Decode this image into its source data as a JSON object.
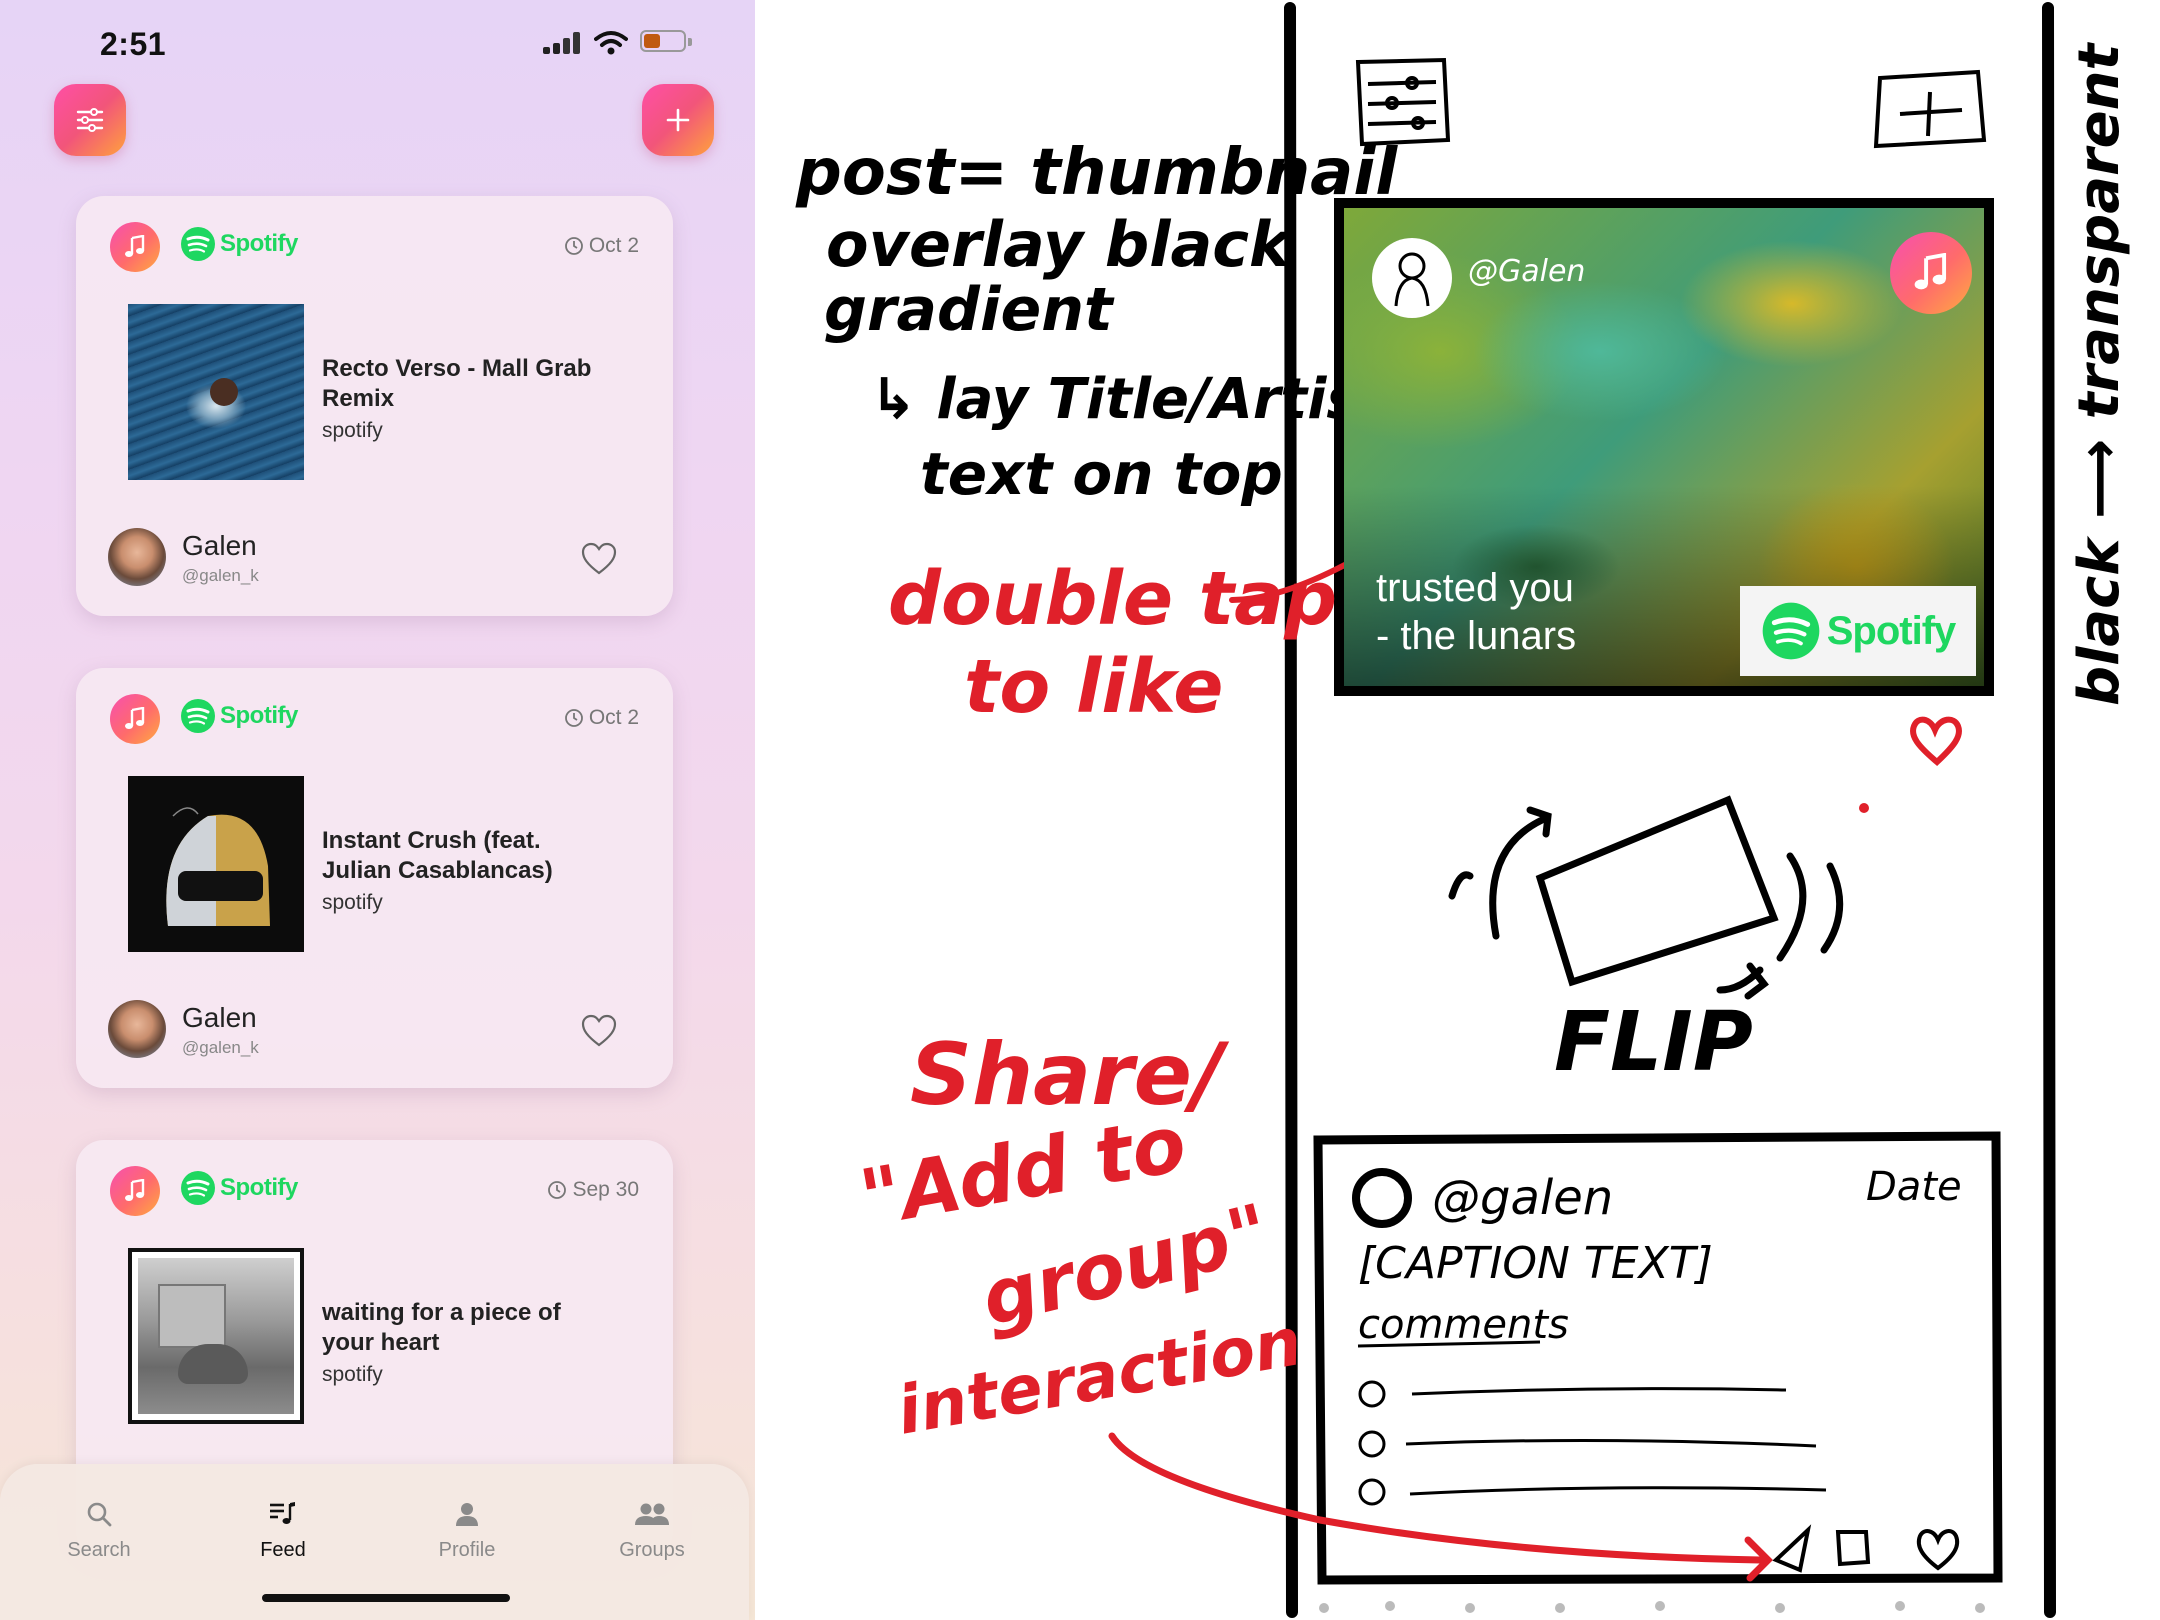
{
  "status_bar": {
    "time": "2:51"
  },
  "header": {
    "filter_icon": "sliders-icon",
    "add_icon": "plus-icon"
  },
  "posts": [
    {
      "source_logo": "Spotify",
      "date": "Oct 2",
      "title": "Recto Verso - Mall Grab Remix",
      "source": "spotify",
      "user": "Galen",
      "handle": "@galen_k"
    },
    {
      "source_logo": "Spotify",
      "date": "Oct 2",
      "title": "Instant Crush (feat. Julian Casablancas)",
      "source": "spotify",
      "user": "Galen",
      "handle": "@galen_k"
    },
    {
      "source_logo": "Spotify",
      "date": "Sep 30",
      "title": "waiting for a piece of your heart",
      "source": "spotify"
    }
  ],
  "tabs": [
    {
      "label": "Search",
      "icon": "search-icon"
    },
    {
      "label": "Feed",
      "icon": "music-list-icon",
      "active": true
    },
    {
      "label": "Profile",
      "icon": "person-icon"
    },
    {
      "label": "Groups",
      "icon": "people-icon"
    }
  ],
  "sketch": {
    "notes": {
      "post_line1": "post= thumbnail",
      "post_line2": "overlay black",
      "post_line3": "gradient",
      "post_line4": "↳ lay Title/Artist",
      "post_line5": "text on top",
      "double_tap1": "double tap",
      "double_tap2": "to like",
      "share1": "Share/",
      "share2": "\"Add to",
      "share3": "group\"",
      "share4": "interaction",
      "flip": "FLIP",
      "side": "black ⟶ transparent"
    },
    "mock_thumbnail": {
      "handle": "@Galen",
      "title_line1": "trusted you",
      "title_line2": "- the lunars",
      "logo": "Spotify"
    },
    "mock_detail": {
      "handle": "@galen",
      "date": "Date",
      "caption": "[CAPTION TEXT]",
      "comments": "comments"
    }
  }
}
